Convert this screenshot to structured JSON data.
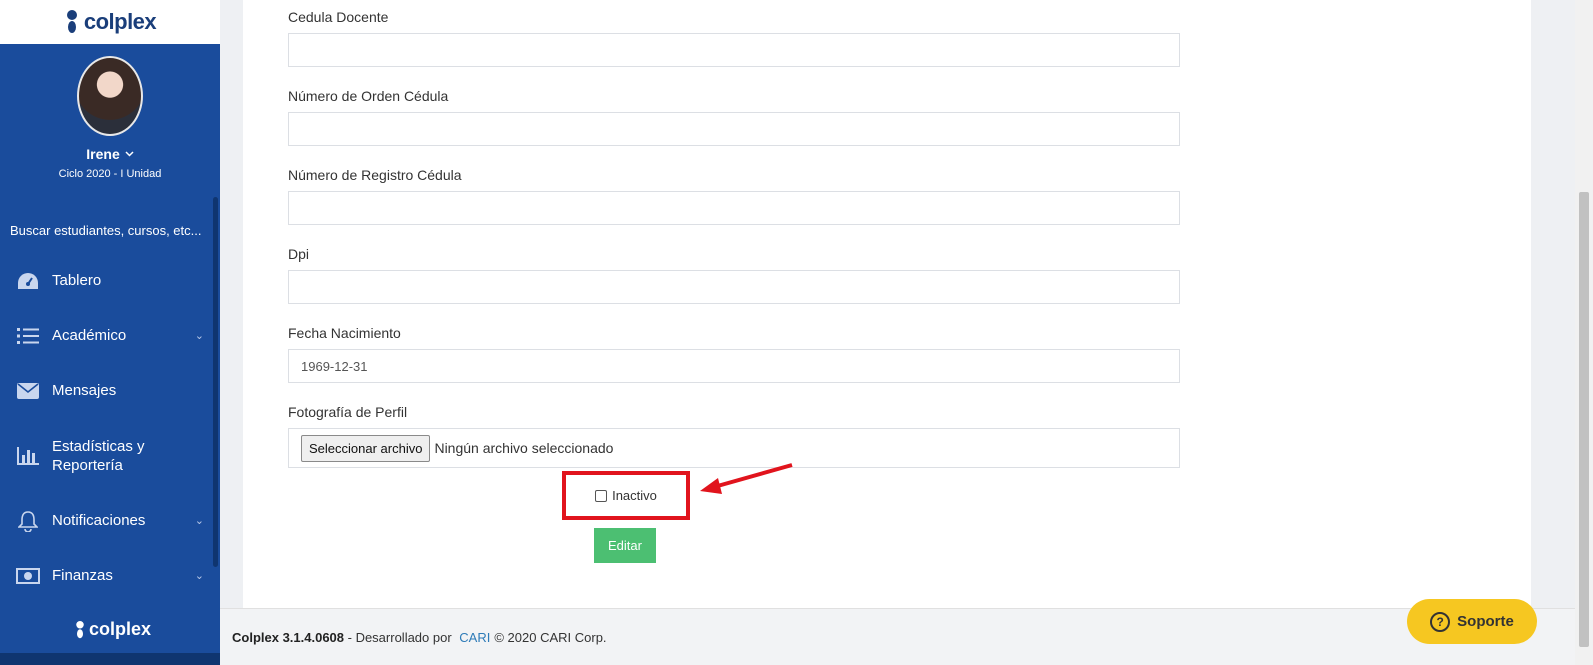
{
  "brand": {
    "name": "colplex"
  },
  "user": {
    "name": "Irene",
    "cycle": "Ciclo 2020 - I Unidad"
  },
  "search": {
    "label": "Buscar estudiantes, cursos, etc..."
  },
  "nav": [
    {
      "label": "Tablero",
      "icon": "dashboard-icon"
    },
    {
      "label": "Académico",
      "icon": "list-icon",
      "has_submenu": true
    },
    {
      "label": "Mensajes",
      "icon": "envelope-icon"
    },
    {
      "label": "Estadísticas y Reportería",
      "icon": "bar-chart-icon"
    },
    {
      "label": "Notificaciones",
      "icon": "bell-icon",
      "has_submenu": true
    },
    {
      "label": "Finanzas",
      "icon": "money-icon",
      "has_submenu": true
    }
  ],
  "form": {
    "fields": [
      {
        "label": "Cedula Docente",
        "value": ""
      },
      {
        "label": "Número de Orden Cédula",
        "value": ""
      },
      {
        "label": "Número de Registro Cédula",
        "value": ""
      },
      {
        "label": "Dpi",
        "value": ""
      },
      {
        "label": "Fecha Nacimiento",
        "value": "1969-12-31"
      }
    ],
    "photo": {
      "label": "Fotografía de Perfil",
      "button_label": "Seleccionar archivo",
      "status": "Ningún archivo seleccionado"
    },
    "inactive_label": "Inactivo",
    "inactive_checked": false,
    "submit_label": "Editar"
  },
  "footer": {
    "app_version": "Colplex 3.1.4.0608",
    "developed_by": " - Desarrollado por ",
    "company_link": "CARI",
    "copyright": "© 2020 CARI Corp."
  },
  "support": {
    "label": "Soporte"
  },
  "colors": {
    "sidebar": "#1a4c9c",
    "accent_green": "#4cbf72",
    "highlight_red": "#e1141d",
    "support_yellow": "#f6c721"
  }
}
